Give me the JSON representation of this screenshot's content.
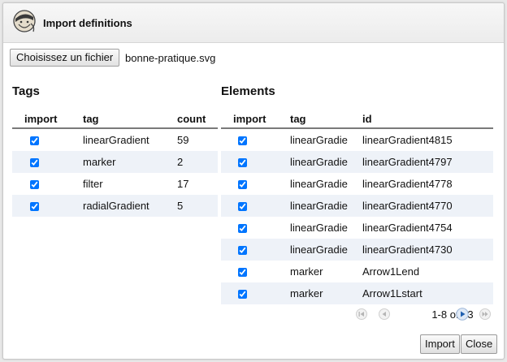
{
  "dialog": {
    "title": "Import definitions"
  },
  "file": {
    "button_label": "Choisissez un fichier",
    "file_name": "bonne-pratique.svg"
  },
  "tags": {
    "heading": "Tags",
    "columns": [
      "import",
      "tag",
      "count"
    ],
    "rows": [
      {
        "checked": true,
        "tag": "linearGradient",
        "count": "59"
      },
      {
        "checked": true,
        "tag": "marker",
        "count": "2"
      },
      {
        "checked": true,
        "tag": "filter",
        "count": "17"
      },
      {
        "checked": true,
        "tag": "radialGradient",
        "count": "5"
      }
    ]
  },
  "elements": {
    "heading": "Elements",
    "columns": [
      "import",
      "tag",
      "id"
    ],
    "rows": [
      {
        "checked": true,
        "tag": "linearGradie",
        "id": "linearGradient4815"
      },
      {
        "checked": true,
        "tag": "linearGradie",
        "id": "linearGradient4797"
      },
      {
        "checked": true,
        "tag": "linearGradie",
        "id": "linearGradient4778"
      },
      {
        "checked": true,
        "tag": "linearGradie",
        "id": "linearGradient4770"
      },
      {
        "checked": true,
        "tag": "linearGradie",
        "id": "linearGradient4754"
      },
      {
        "checked": true,
        "tag": "linearGradie",
        "id": "linearGradient4730"
      },
      {
        "checked": true,
        "tag": "marker",
        "id": "Arrow1Lend"
      },
      {
        "checked": true,
        "tag": "marker",
        "id": "Arrow1Lstart"
      }
    ]
  },
  "pager": {
    "text": "1-8 of 83"
  },
  "buttons": {
    "import": "Import",
    "close": "Close"
  },
  "colors": {
    "row_alt": "#eef2f8",
    "pager_active": "#1f5fb0"
  },
  "icons": {
    "app": "inkscape-icon",
    "first": "first-page-icon",
    "prev": "prev-page-icon",
    "next": "next-page-icon",
    "last": "last-page-icon"
  }
}
